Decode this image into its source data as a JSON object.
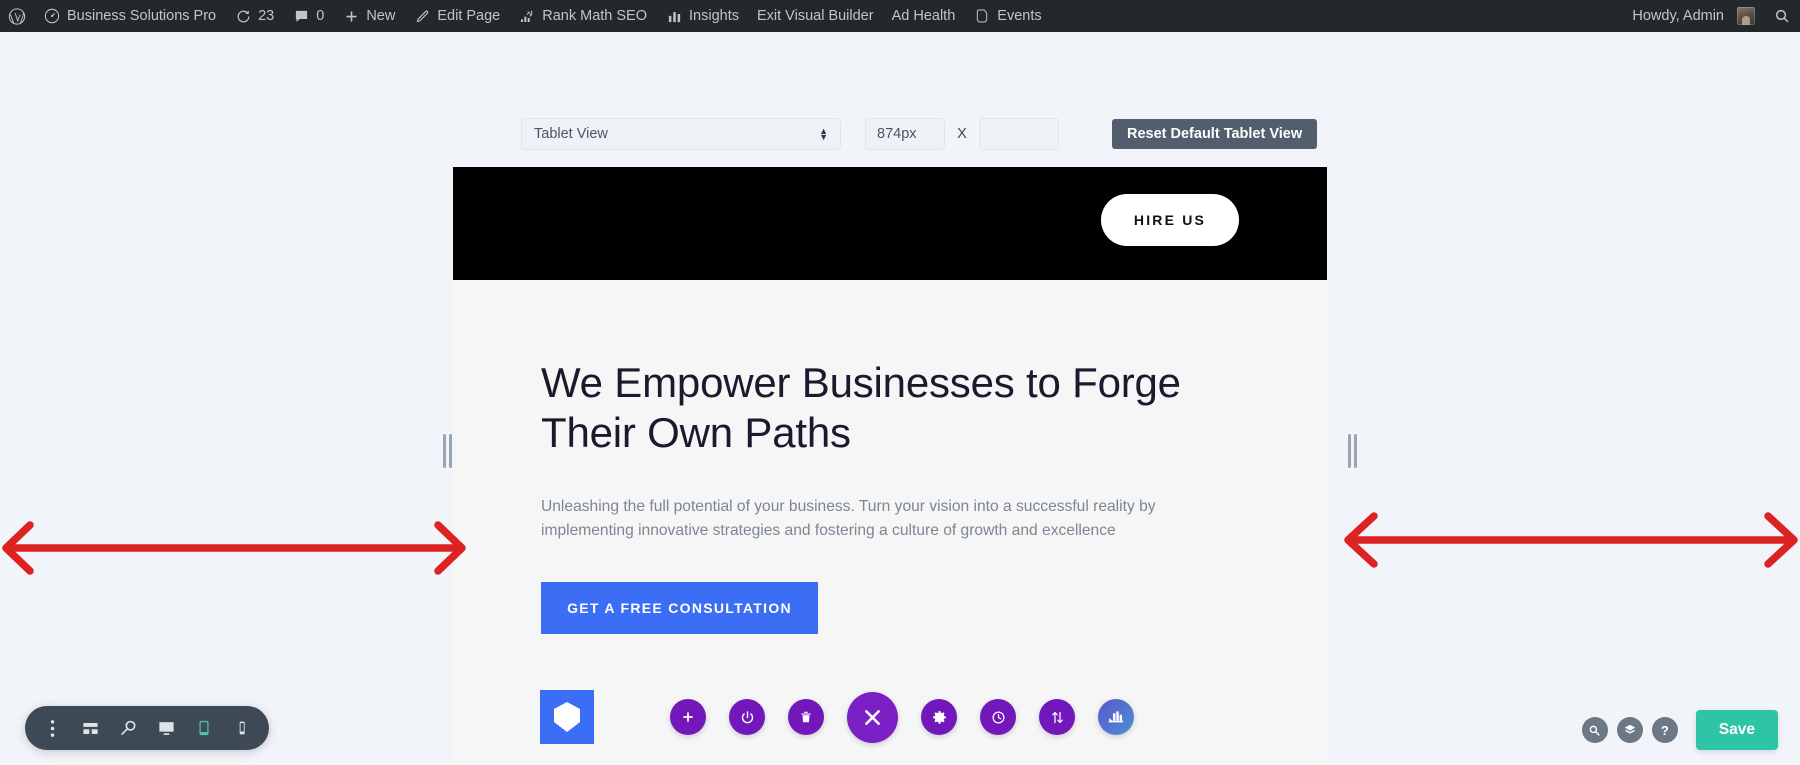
{
  "adminbar": {
    "items": [
      {
        "icon": "wordpress-logo-icon",
        "label": ""
      },
      {
        "icon": "dashboard-icon",
        "label": "Business Solutions Pro"
      },
      {
        "icon": "updates-icon",
        "label": "23"
      },
      {
        "icon": "comments-icon",
        "label": "0"
      },
      {
        "icon": "plus-icon",
        "label": "New"
      },
      {
        "icon": "pencil-icon",
        "label": "Edit Page"
      },
      {
        "icon": "rankmath-icon",
        "label": "Rank Math SEO"
      },
      {
        "icon": "chart-bars-icon",
        "label": "Insights"
      },
      {
        "icon": "",
        "label": "Exit Visual Builder"
      },
      {
        "icon": "",
        "label": "Ad Health"
      },
      {
        "icon": "events-icon",
        "label": "Events"
      }
    ],
    "howdy": "Howdy, Admin",
    "search_icon": "search-icon"
  },
  "responsive_toolbar": {
    "viewport_select": "Tablet View",
    "width_value": "874px",
    "times_symbol": "X",
    "height_value": "",
    "reset_label": "Reset Default Tablet View"
  },
  "preview": {
    "header": {
      "cta_label": "HIRE US"
    },
    "hero": {
      "title": "We Empower Businesses to Forge Their Own Paths",
      "subtitle": "Unleashing the full potential of your business. Turn your vision into a successful reality by implementing innovative strategies and fostering a culture of growth and excellence",
      "button_label": "GET A FREE CONSULTATION"
    },
    "action_icons": [
      {
        "name": "divi-logo-icon",
        "style": "logo"
      },
      {
        "name": "add-icon",
        "style": "normal"
      },
      {
        "name": "power-icon",
        "style": "normal"
      },
      {
        "name": "trash-icon",
        "style": "normal"
      },
      {
        "name": "close-icon",
        "style": "big"
      },
      {
        "name": "settings-gear-icon",
        "style": "normal"
      },
      {
        "name": "history-clock-icon",
        "style": "normal"
      },
      {
        "name": "sort-arrows-icon",
        "style": "normal"
      },
      {
        "name": "stats-bars-icon",
        "style": "grad"
      }
    ]
  },
  "editor_toolbar": {
    "buttons": [
      {
        "name": "more-options-icon",
        "active": false
      },
      {
        "name": "wireframe-icon",
        "active": false
      },
      {
        "name": "zoom-icon",
        "active": false
      },
      {
        "name": "desktop-view-icon",
        "active": false
      },
      {
        "name": "tablet-view-icon",
        "active": true
      },
      {
        "name": "phone-view-icon",
        "active": false
      }
    ]
  },
  "bottom_right": {
    "buttons": [
      {
        "name": "search-icon",
        "glyph": "zoom"
      },
      {
        "name": "layers-icon",
        "glyph": "layers"
      },
      {
        "name": "help-icon",
        "glyph": "?"
      }
    ],
    "save_label": "Save"
  },
  "annotations": {
    "arrow_color": "#dd2222",
    "left_arrow": "double-headed-horizontal-arrow",
    "right_arrow": "double-headed-horizontal-arrow"
  },
  "colors": {
    "adminbar_bg": "#23282d",
    "accent_blue": "#3b6ef5",
    "fab_purple": "#7217ba",
    "save_green": "#2ec4a6",
    "annotation_red": "#dd2222"
  }
}
